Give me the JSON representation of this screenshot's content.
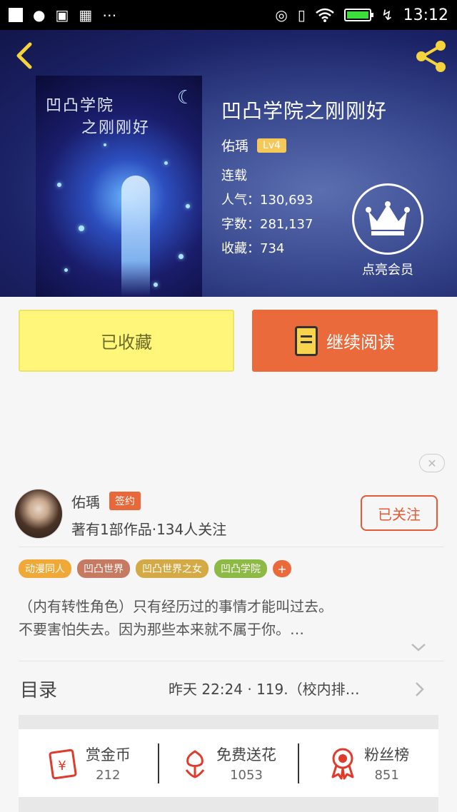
{
  "status_bar": {
    "time": "13:12",
    "left_icons": [
      "square-icon",
      "globe-icon",
      "image-icon",
      "calendar-icon",
      "more-icon"
    ],
    "right_icons": [
      "nfc-icon",
      "vibrate-icon",
      "wifi-icon",
      "battery-icon",
      "charging-icon"
    ]
  },
  "book": {
    "cover_title_line1": "凹凸学院",
    "cover_title_line2": "之刚刚好",
    "title": "凹凸学院之刚刚好",
    "author": "佑瑀",
    "level": "Lv4",
    "status": "连载",
    "popularity": "人气：130,693",
    "word_count": "字数：281,137",
    "favorites": "收藏：734",
    "vip_label": "点亮会员"
  },
  "actions": {
    "collected": "已收藏",
    "continue_reading": "继续阅读"
  },
  "author_info": {
    "name": "佑瑀",
    "badge": "签约",
    "stats": "著有1部作品·134人关注",
    "follow": "已关注"
  },
  "tags": [
    {
      "label": "动漫同人",
      "color": "#f0a936"
    },
    {
      "label": "凹凸世界",
      "color": "#c77a62"
    },
    {
      "label": "凹凸世界之女",
      "color": "#d4aa46"
    },
    {
      "label": "凹凸学院",
      "color": "#8cba45"
    }
  ],
  "tag_more": "+",
  "description_line1": "（内有转性角色）只有经历过的事情才能叫过去。",
  "description_line2": "不要害怕失去。因为那些本来就不属于你。…",
  "toc": {
    "label": "目录",
    "latest": "昨天 22:24 · 119.（校内排…"
  },
  "bottom_stats": [
    {
      "label": "赏金币",
      "value": "212",
      "icon": "coin-icon"
    },
    {
      "label": "免费送花",
      "value": "1053",
      "icon": "flower-icon"
    },
    {
      "label": "粉丝榜",
      "value": "851",
      "icon": "medal-icon"
    }
  ],
  "colors": {
    "accent": "#ea6a3b",
    "collect": "#fff67a",
    "follow": "#e35a33"
  }
}
